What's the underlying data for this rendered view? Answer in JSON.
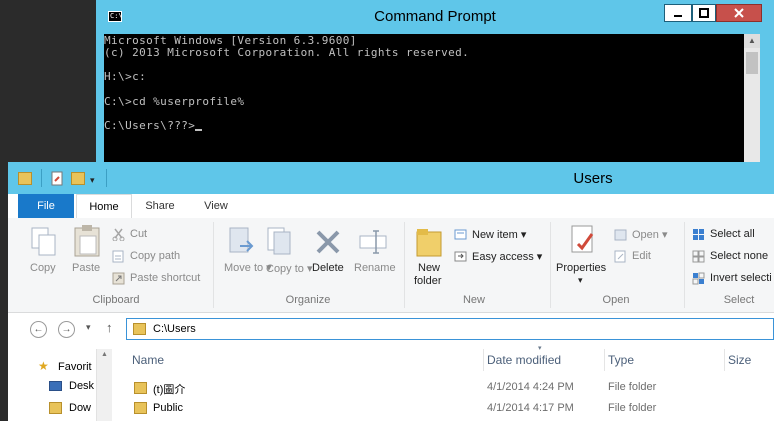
{
  "cmd": {
    "title": "Command Prompt",
    "icon_text": "C:\\",
    "lines": [
      "Microsoft Windows [Version 6.3.9600]",
      "(c) 2013 Microsoft Corporation. All rights reserved.",
      "H:\\>c:",
      "C:\\>cd %userprofile%",
      "C:\\Users\\???>"
    ]
  },
  "explorer": {
    "title": "Users",
    "tabs": {
      "file": "File",
      "home": "Home",
      "share": "Share",
      "view": "View"
    },
    "clipboard": {
      "copy": "Copy",
      "paste": "Paste",
      "cut": "Cut",
      "copy_path": "Copy path",
      "paste_shortcut": "Paste shortcut",
      "label": "Clipboard"
    },
    "organize": {
      "move_to": "Move to ▾",
      "copy_to": "Copy to ▾",
      "delete": "Delete",
      "rename": "Rename",
      "label": "Organize"
    },
    "new": {
      "new_folder_1": "New",
      "new_folder_2": "folder",
      "new_item": "New item ▾",
      "easy_access": "Easy access ▾",
      "label": "New"
    },
    "open": {
      "properties": "Properties",
      "open": "Open ▾",
      "edit": "Edit",
      "label": "Open"
    },
    "select": {
      "select_all": "Select all",
      "select_none": "Select none",
      "invert_selection": "Invert selecti",
      "label": "Select"
    },
    "address": "C:\\Users",
    "nav": {
      "favorites": "Favorit",
      "desktop": "Desk",
      "downloads": "Dow"
    },
    "columns": {
      "name": "Name",
      "date_modified": "Date modified",
      "type": "Type",
      "size": "Size"
    },
    "rows": [
      {
        "name": "(t)圖介",
        "date": "4/1/2014 4:24 PM",
        "type": "File folder"
      },
      {
        "name": "Public",
        "date": "4/1/2014 4:17 PM",
        "type": "File folder"
      }
    ]
  }
}
